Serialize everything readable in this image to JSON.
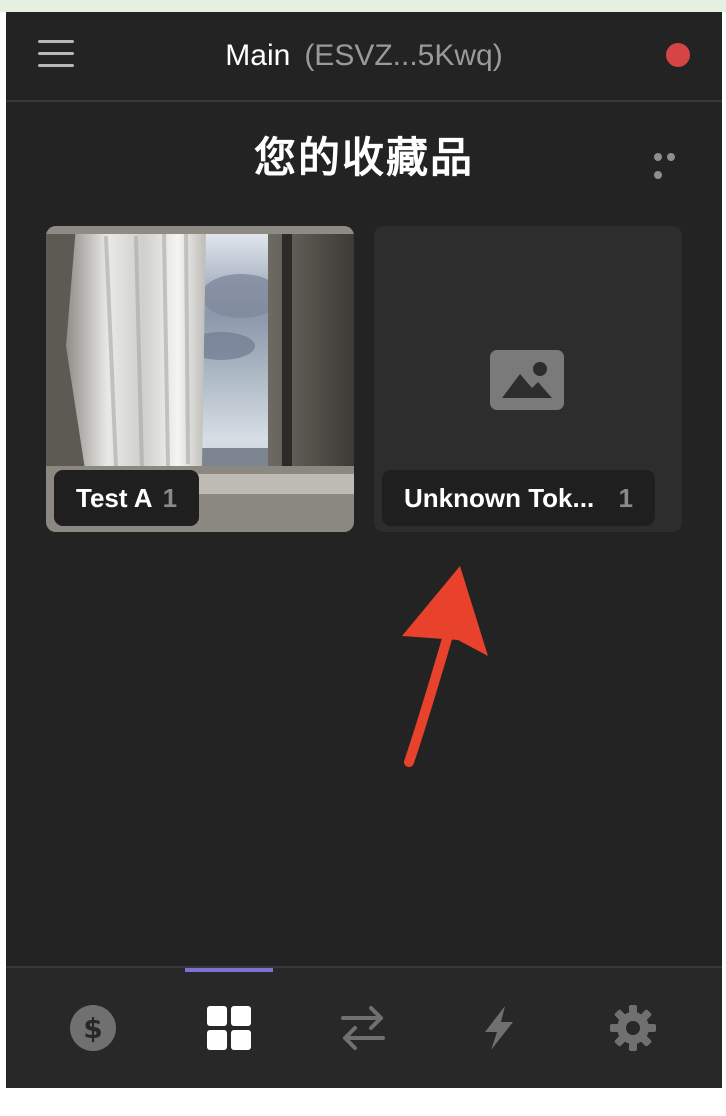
{
  "header": {
    "wallet_name": "Main",
    "wallet_address": "(ESVZ...5Kwq)",
    "menu_icon": "hamburger-menu-icon",
    "connection_status_color": "#d64545"
  },
  "collectibles": {
    "title": "您的收藏品",
    "more_icon": "more-horizontal-icon",
    "items": [
      {
        "name": "Test A",
        "count": "1",
        "image": "window-curtain-photo"
      },
      {
        "name": "Unknown Tok...",
        "count": "1",
        "image": "image-placeholder-icon"
      }
    ]
  },
  "annotation": {
    "arrow_color": "#e8412c"
  },
  "tabbar": {
    "active_index": 1,
    "accent_color": "#7b73d8",
    "tabs": [
      {
        "icon": "dollar-coin-icon"
      },
      {
        "icon": "grid-icon"
      },
      {
        "icon": "swap-arrows-icon"
      },
      {
        "icon": "lightning-icon"
      },
      {
        "icon": "gear-icon"
      }
    ]
  }
}
